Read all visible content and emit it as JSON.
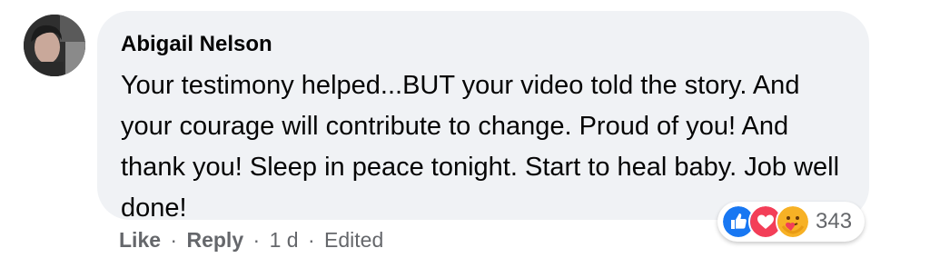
{
  "comment": {
    "author": "Abigail Nelson",
    "text": "Your testimony helped...BUT your video told the story. And your courage will contribute to change. Proud of you! And thank you! Sleep in peace tonight. Start to heal baby. Job well done!"
  },
  "reactions": {
    "icons": [
      "like-icon",
      "love-icon",
      "care-icon"
    ],
    "count": "343",
    "colors": {
      "like": "#1877f2",
      "love": "#f33e58",
      "care": "#f7b125"
    }
  },
  "actions": {
    "like_label": "Like",
    "reply_label": "Reply",
    "separator": "·",
    "time": "1 d",
    "edited_label": "Edited"
  },
  "colors": {
    "bubble_background": "#f0f2f5",
    "text_primary": "#050505",
    "text_secondary": "#65676b"
  }
}
